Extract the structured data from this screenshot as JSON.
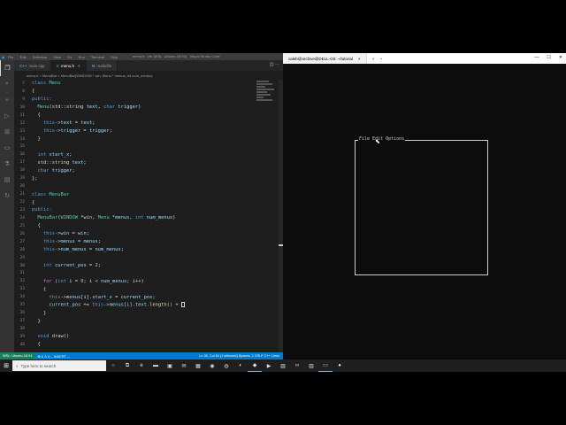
{
  "vscode": {
    "window_title": "menu.h - ctrl (WSL: Ubuntu-18.04) - Visual Studio Code",
    "menu": [
      "File",
      "Edit",
      "Selection",
      "View",
      "Go",
      "Run",
      "Terminal",
      "Help"
    ],
    "tabs": [
      {
        "label": "main.cpp",
        "icon": "C++"
      },
      {
        "label": "menu.h",
        "icon": "C"
      },
      {
        "label": "makefile",
        "icon": "M"
      }
    ],
    "breadcrumb": "menu.h > MenuBar > MenuBar(WINDOW * win, Menu * menus, int num_menus)",
    "code_lines": [
      {
        "n": "7",
        "t": "class Menu"
      },
      {
        "n": "8",
        "t": "{"
      },
      {
        "n": "9",
        "t": "public:"
      },
      {
        "n": "10",
        "t": "  Menu(std::string text, char trigger)"
      },
      {
        "n": "11",
        "t": "  {"
      },
      {
        "n": "12",
        "t": "    this->text = text;"
      },
      {
        "n": "13",
        "t": "    this->trigger = trigger;"
      },
      {
        "n": "14",
        "t": "  }"
      },
      {
        "n": "15",
        "t": ""
      },
      {
        "n": "16",
        "t": "  int start_x;"
      },
      {
        "n": "17",
        "t": "  std::string text;"
      },
      {
        "n": "18",
        "t": "  char trigger;"
      },
      {
        "n": "19",
        "t": "};"
      },
      {
        "n": "20",
        "t": ""
      },
      {
        "n": "21",
        "t": "class MenuBar"
      },
      {
        "n": "22",
        "t": "{"
      },
      {
        "n": "23",
        "t": "public:"
      },
      {
        "n": "24",
        "t": "  MenuBar(WINDOW *win, Menu *menus, int num_menus)"
      },
      {
        "n": "25",
        "t": "  {"
      },
      {
        "n": "26",
        "t": "    this->win = win;"
      },
      {
        "n": "27",
        "t": "    this->menus = menus;"
      },
      {
        "n": "28",
        "t": "    this->num_menus = num_menus;"
      },
      {
        "n": "29",
        "t": ""
      },
      {
        "n": "30",
        "t": "    int current_pos = 2;"
      },
      {
        "n": "31",
        "t": ""
      },
      {
        "n": "32",
        "t": "    for (int i = 0; i < num_menus; i++)"
      },
      {
        "n": "33",
        "t": "    {"
      },
      {
        "n": "34",
        "t": "      this->menus[i].start_x = current_pos;"
      },
      {
        "n": "35",
        "t": "      current_pos += this->menus[i].text.length() + "
      },
      {
        "n": "36",
        "t": "    }"
      },
      {
        "n": "37",
        "t": "  }"
      },
      {
        "n": "38",
        "t": ""
      },
      {
        "n": "39",
        "t": "  void draw()"
      },
      {
        "n": "40",
        "t": "  {"
      }
    ],
    "status": {
      "remote": "WSL: Ubuntu-18.04",
      "left": "⊗ 0 ⚠ 0   -- INSERT --",
      "right": "Ln 35, Col 54 (1 selected)   Spaces: 2   CRLF   C++   Linux"
    }
  },
  "terminal": {
    "tab_label": "caleb@archive@DELL-G5: ~/tutorial",
    "ncurses_menu": "File Edit Options"
  },
  "taskbar": {
    "search_placeholder": "Type here to search"
  }
}
